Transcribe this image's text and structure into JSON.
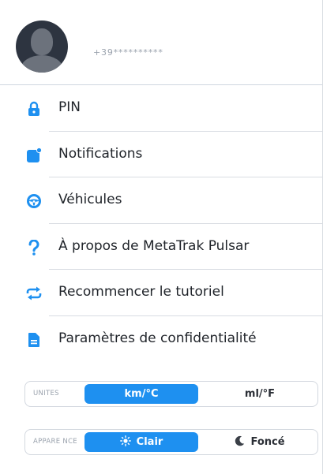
{
  "profile": {
    "phone": "+39**********",
    "avatar_icon": "person-silhouette-icon"
  },
  "menu": {
    "items": [
      {
        "label": "PIN",
        "icon": "lock-icon"
      },
      {
        "label": "Notifications",
        "icon": "notification-badge-icon"
      },
      {
        "label": "Véhicules",
        "icon": "steering-wheel-icon"
      },
      {
        "label": "À propos de MetaTrak Pulsar",
        "icon": "question-mark-icon"
      },
      {
        "label": "Recommencer le tutoriel",
        "icon": "repeat-icon"
      },
      {
        "label": "Paramètres de confidentialité",
        "icon": "document-icon"
      }
    ]
  },
  "units": {
    "label": "UNITES",
    "options": [
      "km/°C",
      "ml/°F"
    ],
    "selected": "km/°C"
  },
  "appearance": {
    "label": "APPARE NCE",
    "options": [
      "Clair",
      "Foncé"
    ],
    "selected": "Clair"
  },
  "colors": {
    "accent": "#1e90f0",
    "icon_blue": "#1e90f0"
  }
}
